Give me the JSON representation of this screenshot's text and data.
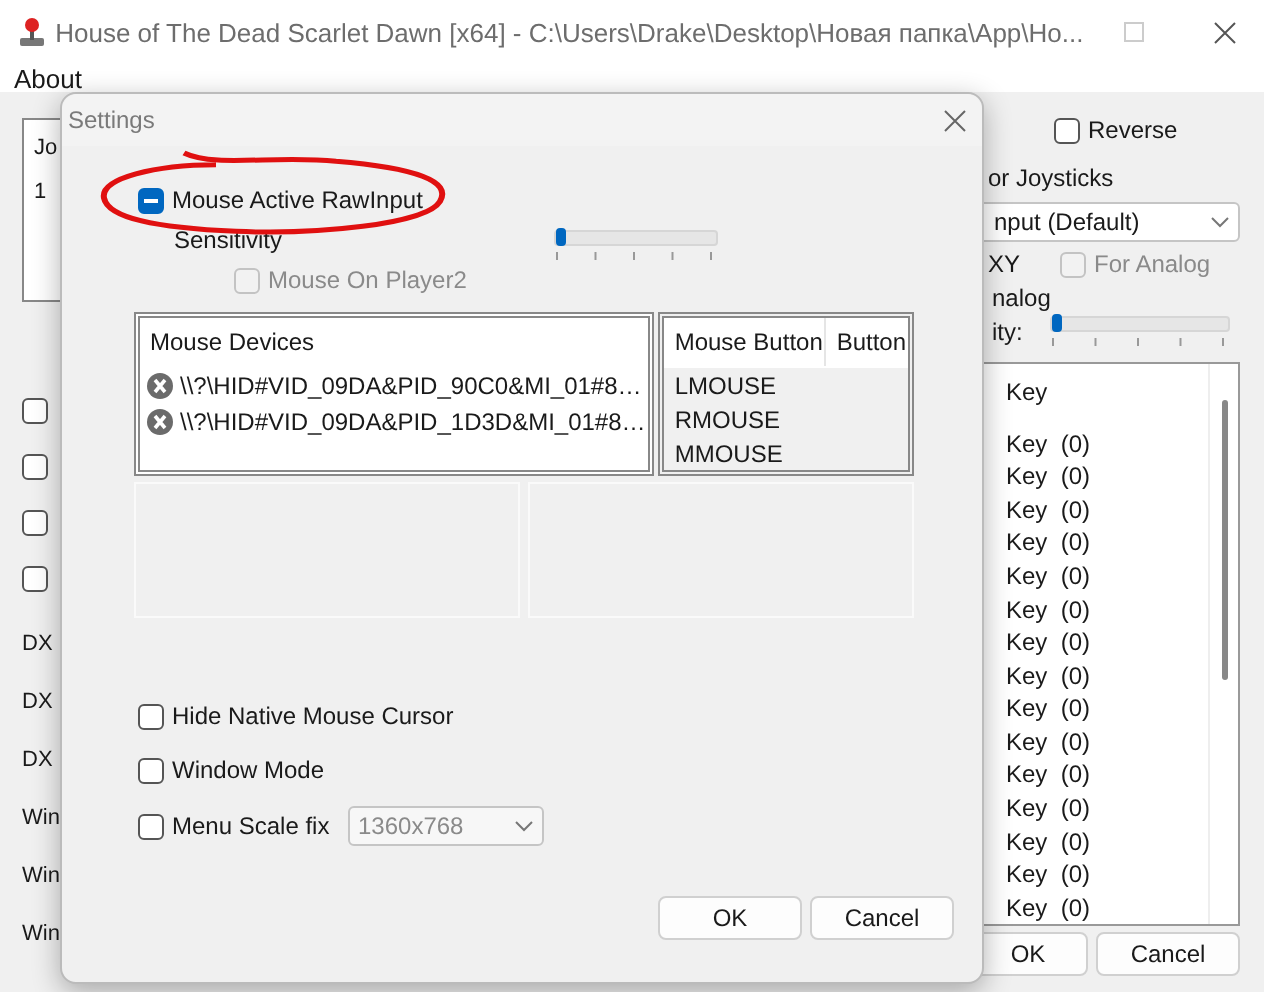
{
  "window": {
    "title": "House of The Dead Scarlet Dawn [x64] - C:\\Users\\Drake\\Desktop\\Новая папка\\App\\Ho..."
  },
  "menu": [
    "About"
  ],
  "left": {
    "list_header": "Jo",
    "list_row": "1",
    "checkboxes": [
      {
        "checked": false
      },
      {
        "checked": false
      },
      {
        "checked": false
      },
      {
        "checked": false
      }
    ],
    "labels": [
      "DX",
      "DX",
      "DX",
      "Win",
      "Win",
      "Win"
    ]
  },
  "right": {
    "reverse": {
      "label": "Reverse",
      "checked": false
    },
    "joysticks_label": "or Joysticks",
    "input_dropdown": "nput (Default)",
    "xy_label": "XY",
    "for_analog": {
      "label": "For Analog",
      "checked": false,
      "disabled": true
    },
    "analog_label": "nalog",
    "sensitivity": {
      "label": "ity:",
      "level": 0
    },
    "key_header": "Key",
    "key_rows": [
      "Key  (0)",
      "Key  (0)",
      "Key  (0)",
      "Key  (0)",
      "Key  (0)",
      "Key  (0)",
      "Key  (0)",
      "Key  (0)",
      "Key  (0)",
      "Key  (0)",
      "Key  (0)",
      "Key  (0)",
      "Key  (0)",
      "Key  (0)",
      "Key  (0)"
    ],
    "buttons": [
      "OK",
      "Cancel"
    ]
  },
  "dialog": {
    "title": "Settings",
    "raw_input": {
      "label": "Mouse Active RawInput",
      "indeterminate": true
    },
    "sensitivity": {
      "label": "Sensitivity",
      "level": 0
    },
    "mouse_on_player2": {
      "label": "Mouse On Player2",
      "checked": false,
      "disabled": true
    },
    "devices": {
      "header": "Mouse Devices",
      "rows": [
        "\\\\?\\HID#VID_09DA&PID_90C0&MI_01#8…",
        "\\\\?\\HID#VID_09DA&PID_1D3D&MI_01#8…"
      ]
    },
    "mouse_buttons": {
      "columns": [
        "Mouse Button",
        "Button"
      ],
      "rows": [
        "LMOUSE",
        "RMOUSE",
        "MMOUSE"
      ]
    },
    "options": [
      {
        "label": "Hide Native Mouse Cursor",
        "checked": false
      },
      {
        "label": "Window Mode",
        "checked": false
      },
      {
        "label": "Menu Scale fix",
        "checked": false
      }
    ],
    "resolution": {
      "value": "1360x768",
      "disabled": true
    },
    "buttons": [
      "OK",
      "Cancel"
    ]
  }
}
